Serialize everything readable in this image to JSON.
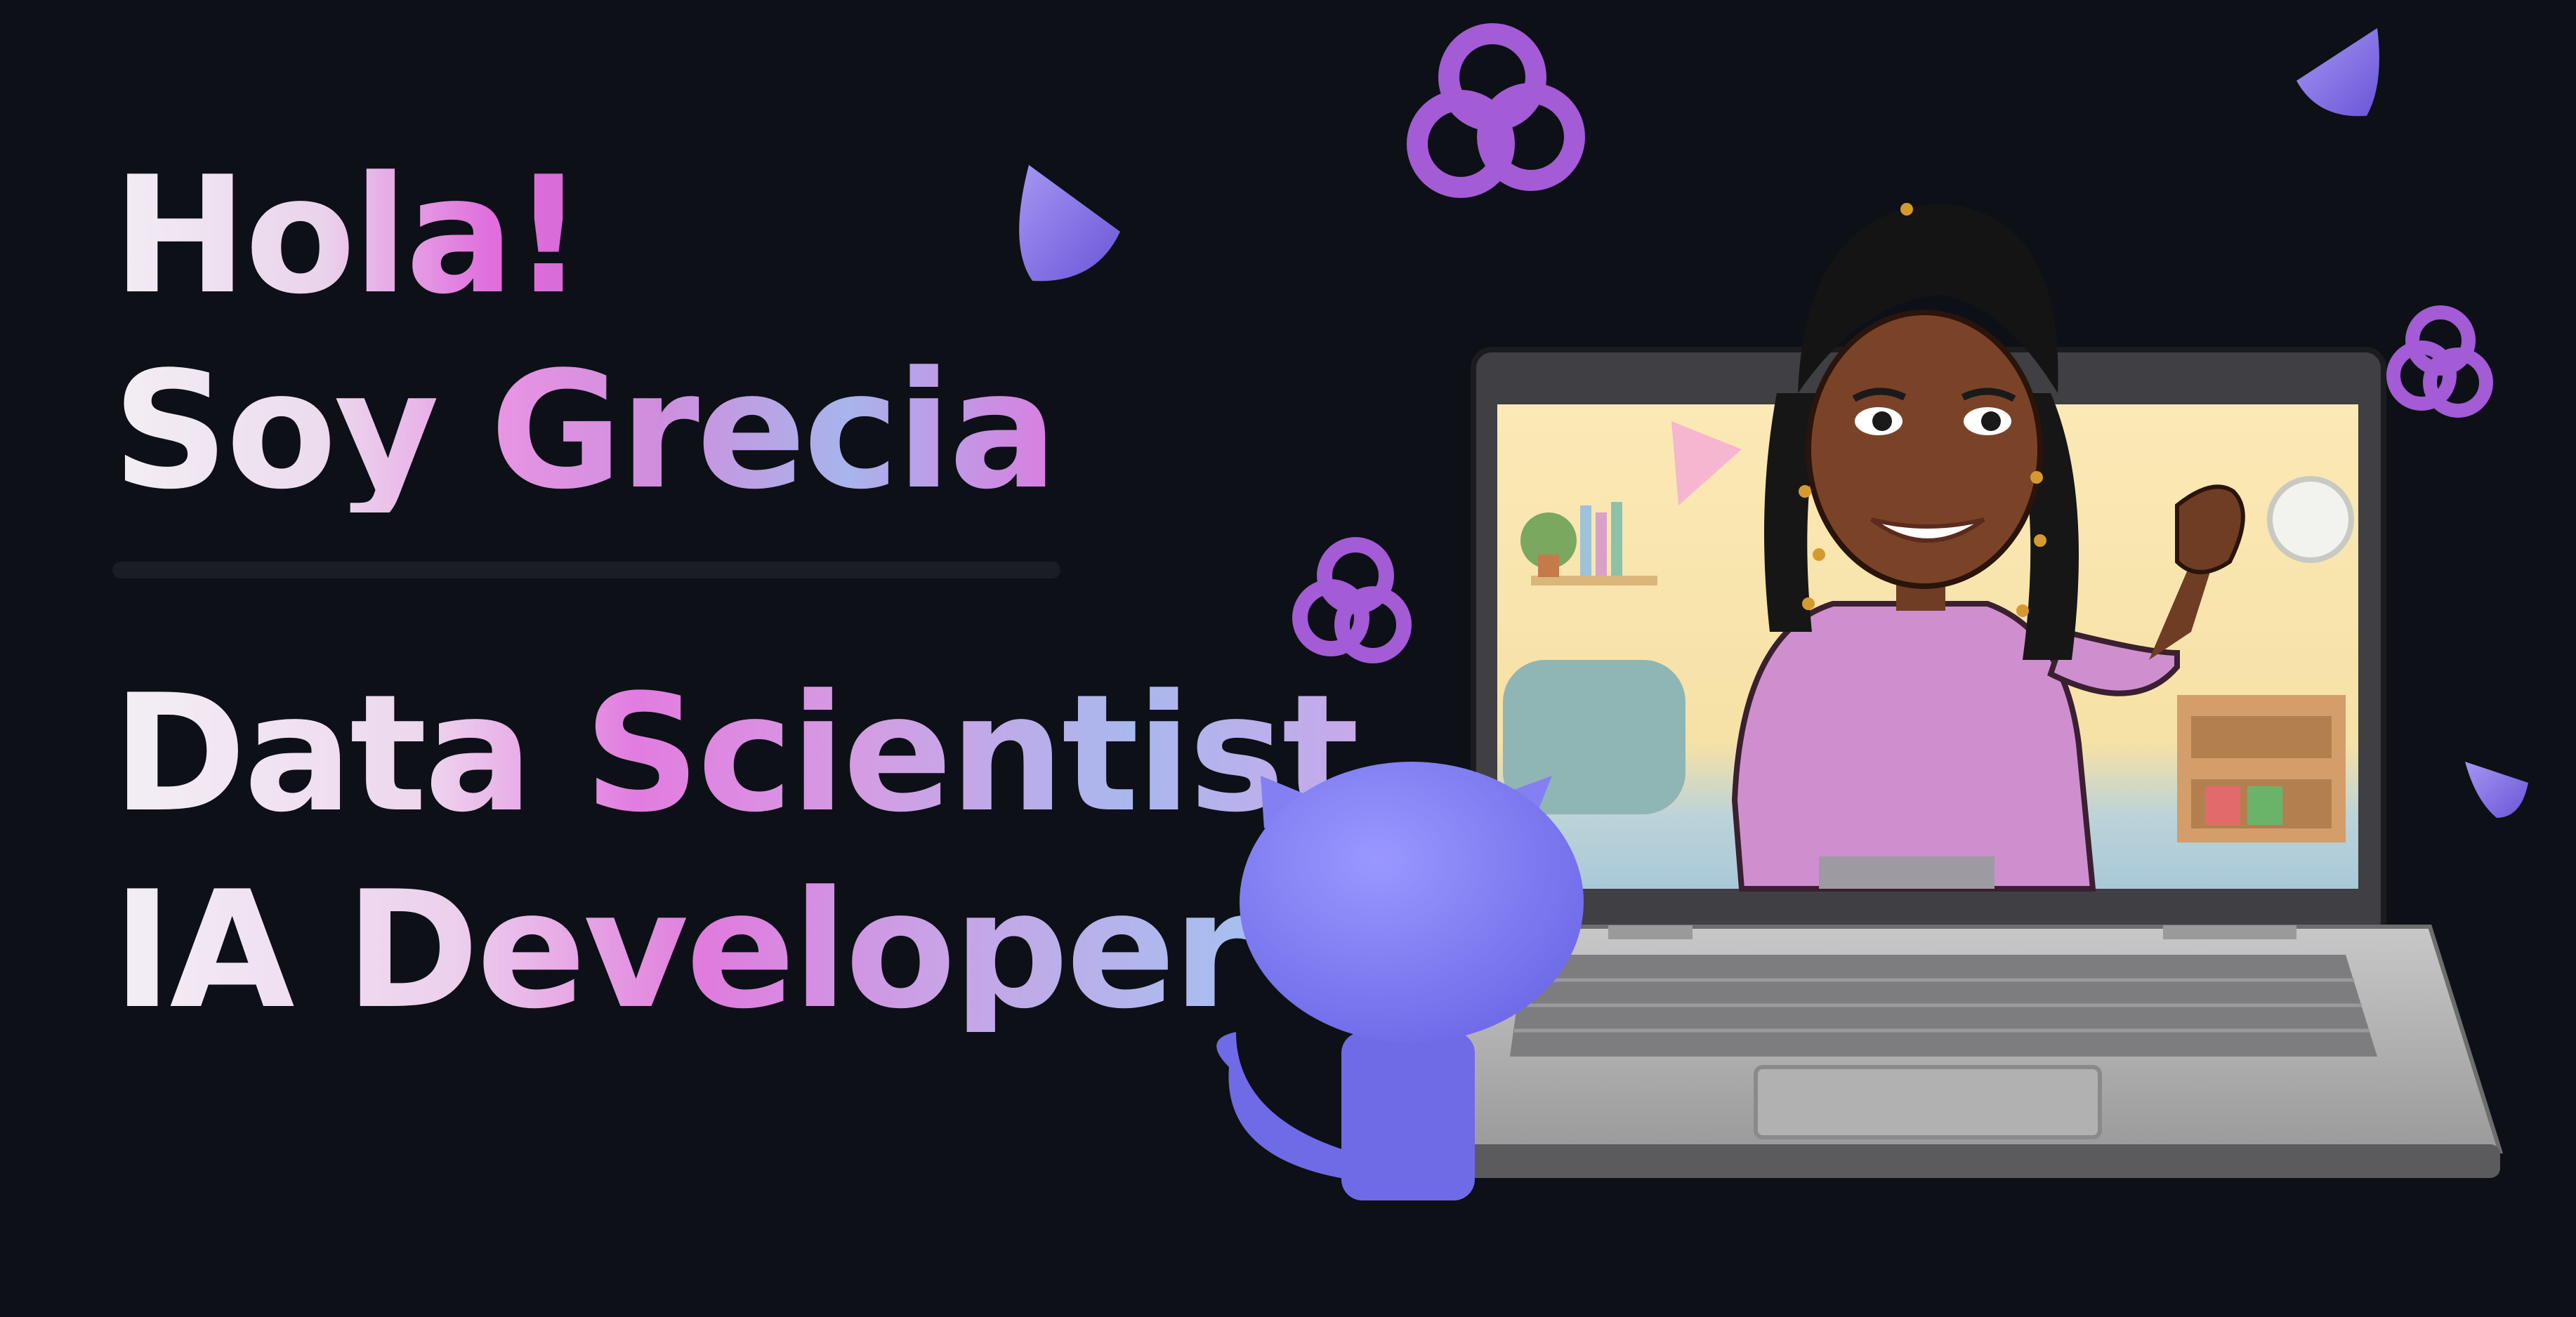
{
  "greeting": {
    "line1": "Hola!",
    "line2": "Soy Grecia"
  },
  "roles": {
    "line1": "Data Scientist",
    "line2": "IA Developer"
  },
  "illustration": {
    "subjects": [
      "laptop",
      "avatar",
      "octocat-figure",
      "trefoil-knot-icon",
      "cone-icon"
    ]
  },
  "colors": {
    "background": "#0d1017",
    "accent_pink": "#e07bdd",
    "accent_blue": "#a6c0ef",
    "accent_purple": "#a35bd6",
    "octocat": "#7470ee"
  }
}
